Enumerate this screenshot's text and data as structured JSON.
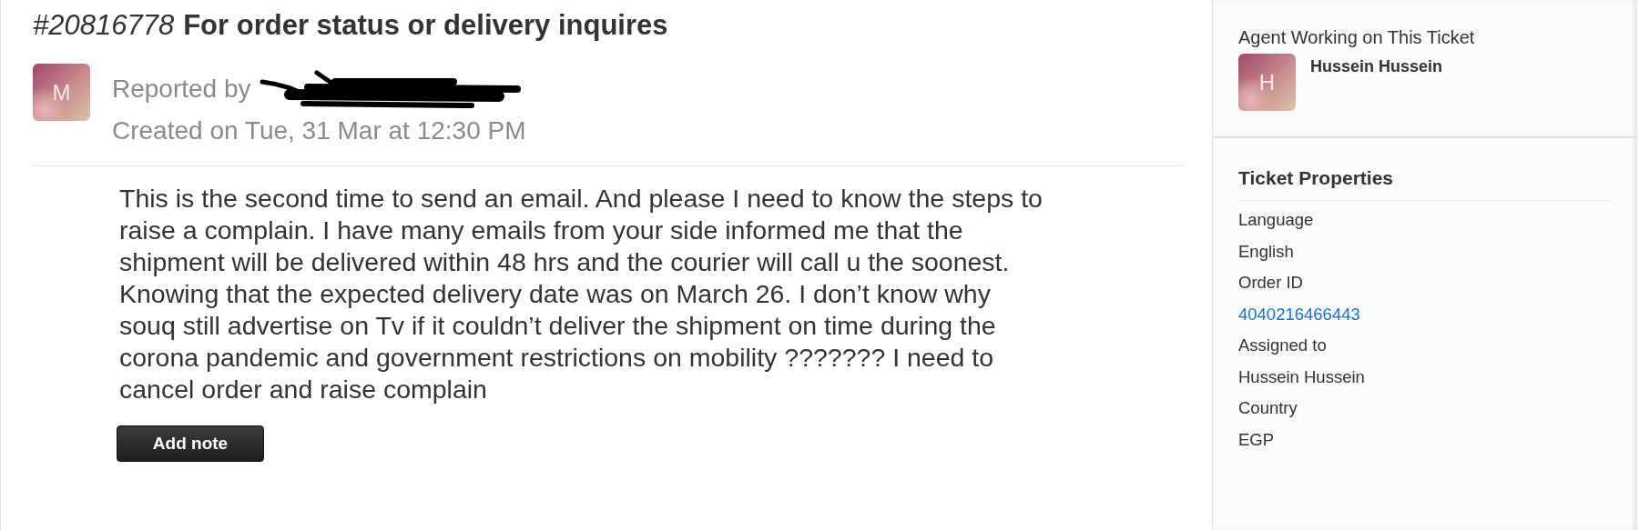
{
  "ticket": {
    "number": "#20816778",
    "subject": "For order status or delivery inquires",
    "reporter": {
      "avatar_letter": "M",
      "reported_label": "Reported by",
      "name_redacted": true,
      "created": "Created on Tue, 31 Mar at 12:30 PM"
    },
    "message": "This is the second time to send an email. And please I need to know the steps to raise a complain. I have many emails from your side informed me that the shipment will be delivered within 48 hrs and the courier will call u the soonest. Knowing that the expected delivery date was on March 26. I don’t know why souq still advertise on Tv if it couldn’t deliver the shipment on time during the corona pandemic and government restrictions on mobility ??????? I need to cancel order and raise complain",
    "add_note_button": "Add note"
  },
  "sidebar": {
    "agent_heading": "Agent Working on This Ticket",
    "agent": {
      "avatar_letter": "H",
      "name": "Hussein Hussein"
    },
    "properties_heading": "Ticket Properties",
    "properties": [
      {
        "label": "Language",
        "value": "English",
        "link": false
      },
      {
        "label": "Order ID",
        "value": "4040216466443",
        "link": true
      },
      {
        "label": "Assigned to",
        "value": "Hussein Hussein",
        "link": false
      },
      {
        "label": "Country",
        "value": "EGP",
        "link": false
      }
    ]
  }
}
